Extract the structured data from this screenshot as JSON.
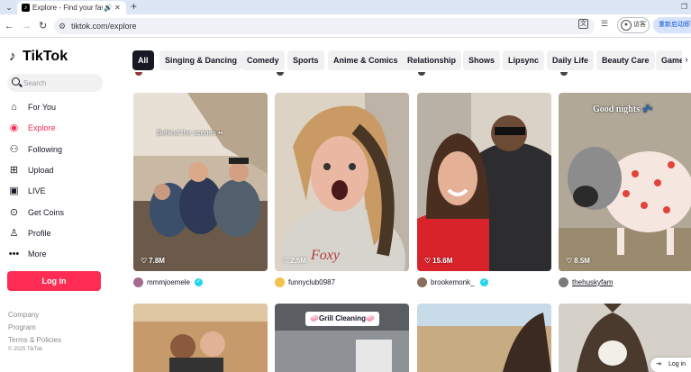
{
  "browser": {
    "tab_title": "Explore - Find your favou",
    "url": "tiktok.com/explore",
    "visitor_label": "访客",
    "relaunch_label": "重新启动即可"
  },
  "sidebar": {
    "logo": "TikTok",
    "search_placeholder": "Search",
    "nav": [
      {
        "label": "For You",
        "icon": "home-icon"
      },
      {
        "label": "Explore",
        "icon": "compass-icon"
      },
      {
        "label": "Following",
        "icon": "following-icon"
      },
      {
        "label": "Upload",
        "icon": "upload-icon"
      },
      {
        "label": "LIVE",
        "icon": "live-icon"
      },
      {
        "label": "Get Coins",
        "icon": "coins-icon"
      },
      {
        "label": "Profile",
        "icon": "profile-icon"
      },
      {
        "label": "More",
        "icon": "more-icon"
      }
    ],
    "login_label": "Log in",
    "footer": [
      "Company",
      "Program",
      "Terms & Policies"
    ],
    "copyright": "© 2025 TikTok"
  },
  "categories": [
    "All",
    "Singing & Dancing",
    "Comedy",
    "Sports",
    "Anime & Comics",
    "Relationship",
    "Shows",
    "Lipsync",
    "Daily Life",
    "Beauty Care",
    "Games"
  ],
  "active_category": "All",
  "videos": [
    {
      "likes": "7.8M",
      "author": "mmmjoemele",
      "verified": true,
      "overlay": "Behind the scenes ••"
    },
    {
      "likes": "2.5M",
      "author": "funnyclub0987",
      "verified": false,
      "overlay": ""
    },
    {
      "likes": "15.6M",
      "author": "brookemonk_",
      "verified": true,
      "overlay": ""
    },
    {
      "likes": "8.5M",
      "author": "thehuskyfam",
      "verified": false,
      "overlay": "Good nights 💤"
    }
  ],
  "second_row": [
    {
      "overlay": ""
    },
    {
      "overlay": "🧼Grill Cleaning🧼"
    },
    {
      "overlay": ""
    },
    {
      "overlay": ""
    }
  ],
  "floating_login_label": "Log in",
  "colors": {
    "brand": "#fe2c55",
    "verified": "#20d5ec"
  }
}
